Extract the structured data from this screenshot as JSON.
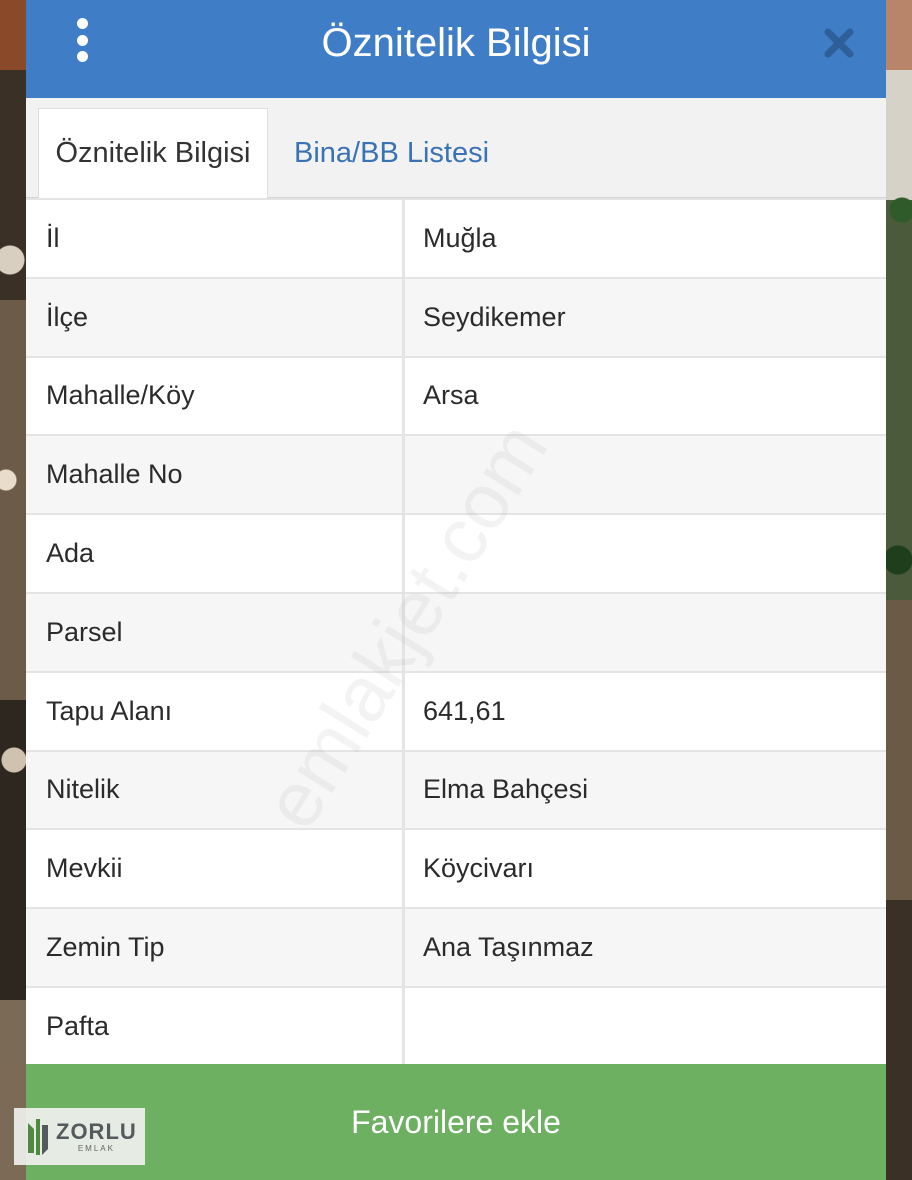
{
  "dialog": {
    "title": "Öznitelik Bilgisi"
  },
  "tabs": [
    {
      "label": "Öznitelik Bilgisi",
      "active": true
    },
    {
      "label": "Bina/BB Listesi",
      "active": false
    }
  ],
  "attributes": [
    {
      "label": "İl",
      "value": "Muğla"
    },
    {
      "label": "İlçe",
      "value": "Seydikemer"
    },
    {
      "label": "Mahalle/Köy",
      "value": "Arsa"
    },
    {
      "label": "Mahalle No",
      "value": ""
    },
    {
      "label": "Ada",
      "value": ""
    },
    {
      "label": "Parsel",
      "value": ""
    },
    {
      "label": "Tapu Alanı",
      "value": "641,61"
    },
    {
      "label": "Nitelik",
      "value": "Elma Bahçesi"
    },
    {
      "label": "Mevkii",
      "value": "Köycivarı"
    },
    {
      "label": "Zemin Tip",
      "value": "Ana Taşınmaz"
    },
    {
      "label": "Pafta",
      "value": ""
    }
  ],
  "actions": {
    "favorite_label": "Favorilere ekle"
  },
  "watermark": "emlakjet.com",
  "logo": {
    "name": "ZORLU",
    "sub": "EMLAK"
  },
  "colors": {
    "header": "#3f7dc6",
    "tab_link": "#3a72b4",
    "favorite_button": "#6eb062"
  },
  "icons": {
    "menu": "vertical-dots-icon",
    "close": "close-icon"
  }
}
